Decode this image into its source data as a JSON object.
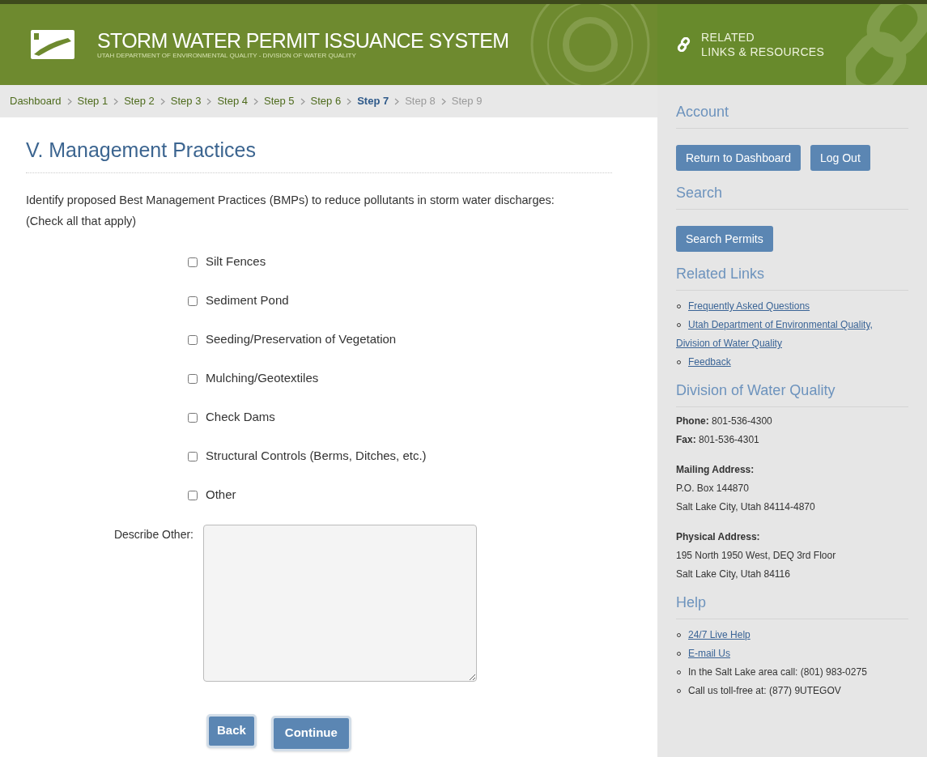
{
  "header": {
    "title": "STORM WATER PERMIT ISSUANCE SYSTEM",
    "subtitle": "UTAH DEPARTMENT OF ENVIRONMENTAL QUALITY - DIVISION OF WATER QUALITY"
  },
  "breadcrumb": [
    {
      "label": "Dashboard",
      "selected": false,
      "disabled": false
    },
    {
      "label": "Step 1",
      "selected": false,
      "disabled": false
    },
    {
      "label": "Step 2",
      "selected": false,
      "disabled": false
    },
    {
      "label": "Step 3",
      "selected": false,
      "disabled": false
    },
    {
      "label": "Step 4",
      "selected": false,
      "disabled": false
    },
    {
      "label": "Step 5",
      "selected": false,
      "disabled": false
    },
    {
      "label": "Step 6",
      "selected": false,
      "disabled": false
    },
    {
      "label": "Step 7",
      "selected": true,
      "disabled": false
    },
    {
      "label": "Step 8",
      "selected": false,
      "disabled": true
    },
    {
      "label": "Step 9",
      "selected": false,
      "disabled": true
    }
  ],
  "page": {
    "heading": "V. Management Practices",
    "intro": "Identify proposed Best Management Practices (BMPs) to reduce pollutants in storm water discharges:",
    "hint": "(Check all that apply)",
    "options": [
      {
        "label": "Silt Fences",
        "checked": false
      },
      {
        "label": "Sediment Pond",
        "checked": false
      },
      {
        "label": "Seeding/Preservation of Vegetation",
        "checked": false
      },
      {
        "label": "Mulching/Geotextiles",
        "checked": false
      },
      {
        "label": "Check Dams",
        "checked": false
      },
      {
        "label": "Structural Controls (Berms, Ditches, etc.)",
        "checked": false
      },
      {
        "label": "Other",
        "checked": false
      }
    ],
    "describe_label": "Describe Other:",
    "buttons": [
      "Back",
      "Continue"
    ]
  },
  "sidebar": {
    "header": [
      "RELATED",
      "LINKS & RESOURCES"
    ],
    "sections": [
      {
        "title": "Account",
        "kind": "buttons",
        "buttons": [
          "Return to Dashboard",
          "Log Out"
        ]
      },
      {
        "title": "Search",
        "kind": "buttons",
        "buttons": [
          "Search Permits"
        ]
      },
      {
        "title": "Related Links",
        "kind": "list",
        "items": [
          {
            "text": "Frequently Asked Questions",
            "kind": "link"
          },
          {
            "text": "Utah Department of Environmental Quality, Division of Water Quality",
            "kind": "link"
          },
          {
            "text": "Feedback",
            "kind": "link"
          }
        ]
      },
      {
        "title": "Division of Water Quality",
        "kind": "contact",
        "blocks": [
          {
            "lines": [
              "**Phone:** 801-536-4300",
              "**Fax:** 801-536-4301"
            ]
          },
          {
            "heading": "Mailing Address:",
            "lines": [
              "P.O. Box 144870",
              "Salt Lake City, Utah 84114-4870"
            ]
          },
          {
            "heading": "Physical Address:",
            "lines": [
              "195 North 1950 West, DEQ 3rd Floor",
              "Salt Lake City, Utah 84116"
            ]
          }
        ]
      },
      {
        "title": "Help",
        "kind": "list",
        "items": [
          {
            "text": "24/7 Live Help",
            "kind": "link"
          },
          {
            "text": "E-mail Us",
            "kind": "link"
          },
          {
            "text": "In the Salt Lake area call: (801) 983-0275",
            "kind": "text"
          },
          {
            "text": "Call us toll-free at: (877) 9UTEGOV",
            "kind": "text"
          }
        ]
      }
    ]
  }
}
